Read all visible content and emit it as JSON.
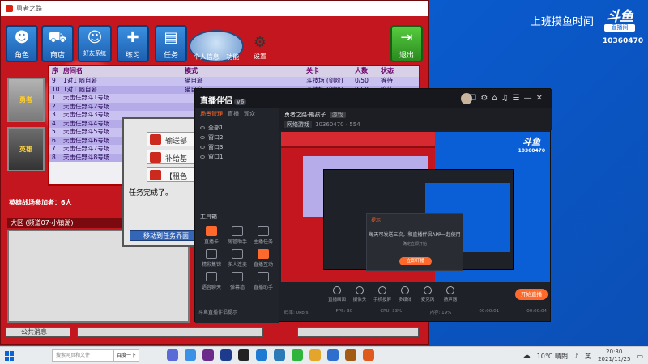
{
  "desktop": {
    "stream_title": "上班摸鱼时间",
    "logo_mark": "斗鱼",
    "logo_sub": "直播间",
    "room_id": "10360470"
  },
  "game": {
    "window_title": "勇者之路",
    "toolbar": [
      {
        "label": "角色",
        "icon": "person-icon"
      },
      {
        "label": "商店",
        "icon": "cart-icon"
      },
      {
        "label": "好友系统",
        "icon": "friends-icon"
      },
      {
        "label": "练习",
        "icon": "practice-icon"
      },
      {
        "label": "任务",
        "icon": "task-icon"
      }
    ],
    "mascot_labels": [
      "个人信息",
      "功能"
    ],
    "settings_label": "设置",
    "exit_label": "退出",
    "side_avatars": [
      {
        "label": "勇者"
      },
      {
        "label": "英雄"
      }
    ],
    "table": {
      "headers": [
        "序",
        "房间名",
        "模式",
        "关卡",
        "人数",
        "状态"
      ],
      "rows": [
        {
          "no": "9",
          "name": "1对1 随自窘",
          "mode": "猫自窘",
          "level": "斗技场 (剑阶)",
          "count": "0/50",
          "status": "等待"
        },
        {
          "no": "10",
          "name": "1对1 随自窘",
          "mode": "猫自窘",
          "level": "斗技场 (剑阶)",
          "count": "0/50",
          "status": "等待"
        },
        {
          "no": "1",
          "name": "天击任野斗1号场",
          "mode": "",
          "level": "",
          "count": "",
          "status": ""
        },
        {
          "no": "2",
          "name": "天击任野斗2号场",
          "mode": "",
          "level": "",
          "count": "",
          "status": ""
        },
        {
          "no": "3",
          "name": "天击任野斗3号场",
          "mode": "",
          "level": "",
          "count": "",
          "status": ""
        },
        {
          "no": "4",
          "name": "天击任野斗4号场",
          "mode": "",
          "level": "",
          "count": "",
          "status": ""
        },
        {
          "no": "5",
          "name": "天击任野斗5号场",
          "mode": "",
          "level": "",
          "count": "",
          "status": ""
        },
        {
          "no": "6",
          "name": "天击任野斗6号场",
          "mode": "",
          "level": "",
          "count": "",
          "status": ""
        },
        {
          "no": "7",
          "name": "天击任野斗7号场",
          "mode": "",
          "level": "",
          "count": "",
          "status": ""
        },
        {
          "no": "8",
          "name": "天击任野斗8号场",
          "mode": "",
          "level": "",
          "count": "",
          "status": ""
        }
      ]
    },
    "hero_count": "英雄战场参加者：6人",
    "region": "大区 (频道07·小镇湖)",
    "public_msg": "公共消息",
    "dialog": {
      "options": [
        "输送部",
        "补给基",
        "【租色"
      ],
      "text": "任务完成了。",
      "button": "移动到任务界面"
    }
  },
  "studio": {
    "app_name": "直播伴侣",
    "version": "v6",
    "tabs": [
      "场景管理",
      "直播",
      "观众"
    ],
    "scenes": [
      "全部1",
      "窗口2",
      "窗口3",
      "窗口1"
    ],
    "tool_title": "工具箱",
    "tools": [
      {
        "label": "直播卡",
        "hot": true
      },
      {
        "label": "房管助手",
        "hot": false
      },
      {
        "label": "主播任务",
        "hot": false
      },
      {
        "label": "精彩集锦",
        "hot": false
      },
      {
        "label": "多人连麦",
        "hot": false
      },
      {
        "label": "直播互动",
        "hot": true
      },
      {
        "label": "语音聊天",
        "hot": false
      },
      {
        "label": "弹幕墙",
        "hot": false
      },
      {
        "label": "直播助手",
        "hot": false
      }
    ],
    "notice": "斗鱼直播伴侣提示",
    "room_title": "勇者之路-熊孩子",
    "room_tag": "游戏",
    "meta_label": "网络游戏",
    "meta_id": "10360470",
    "meta_viewers": "554",
    "popup": {
      "header": "提示",
      "body": "每天可发送三次，和直播伴侣APP一起使用",
      "sub": "确定立即开始",
      "ok": "立即开播"
    },
    "preview_logo": "斗鱼",
    "preview_id": "10360470",
    "bottom_tools": [
      "直播画面",
      "摄像头",
      "手机投屏",
      "多媒体",
      "麦克风",
      "扬声器"
    ],
    "go_live": "开始直播",
    "stats": [
      "码率: 0kb/s",
      "FPS: 30",
      "CPU: 33%",
      "内存: 19%",
      "00:00:01",
      "00:00:04"
    ]
  },
  "taskbar": {
    "search_placeholder": "搜索网页和文件",
    "search_button": "百度一下",
    "temperature": "10°C 晴朗",
    "ime": "英",
    "time": "20:30",
    "date": "2021/11/25"
  }
}
